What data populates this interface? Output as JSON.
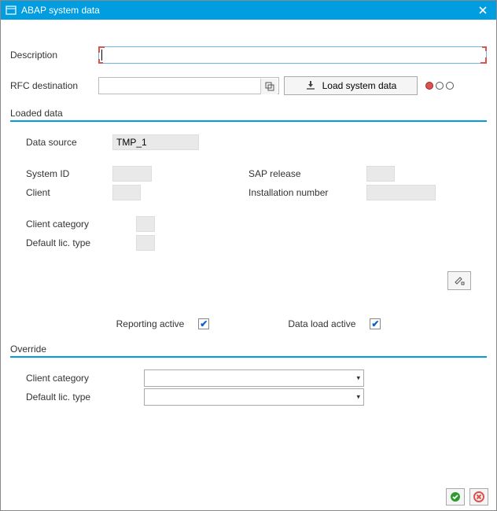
{
  "window": {
    "title": "ABAP system data"
  },
  "description": {
    "label": "Description",
    "value": ""
  },
  "rfc": {
    "label": "RFC destination",
    "value": "",
    "load_button": "Load system data"
  },
  "status": {
    "lights": [
      "red",
      "off",
      "off"
    ]
  },
  "loaded": {
    "title": "Loaded data",
    "data_source_label": "Data source",
    "data_source_value": "TMP_1",
    "system_id_label": "System ID",
    "system_id_value": "",
    "sap_release_label": "SAP release",
    "sap_release_value": "",
    "client_label": "Client",
    "client_value": "",
    "install_no_label": "Installation number",
    "install_no_value": "",
    "client_cat_label": "Client category",
    "client_cat_value": "",
    "default_lic_label": "Default lic. type",
    "default_lic_value": ""
  },
  "checks": {
    "reporting_label": "Reporting active",
    "reporting_checked": true,
    "data_load_label": "Data load active",
    "data_load_checked": true
  },
  "override": {
    "title": "Override",
    "client_cat_label": "Client category",
    "client_cat_value": "",
    "default_lic_label": "Default lic. type",
    "default_lic_value": ""
  }
}
